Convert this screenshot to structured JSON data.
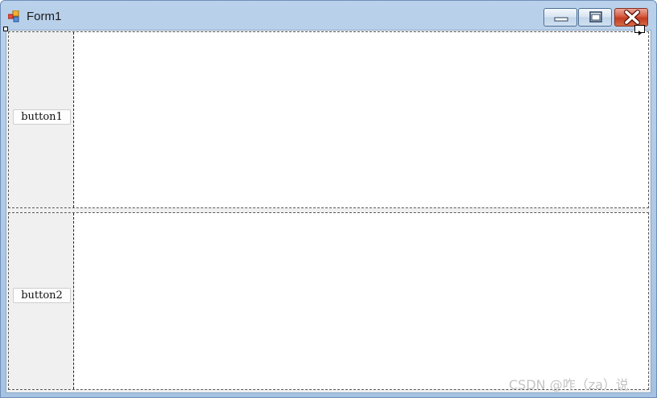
{
  "window": {
    "title": "Form1",
    "controls": {
      "minimize_icon": "minimize-icon",
      "maximize_icon": "maximize-icon",
      "close_icon": "close-icon"
    },
    "colors": {
      "titlebar": "#b9d1ea",
      "close_button": "#c23b20",
      "client_background": "#f0f0f0"
    }
  },
  "panels": [
    {
      "button_label": "button1"
    },
    {
      "button_label": "button2"
    }
  ],
  "watermark": "CSDN @咋（za）说"
}
